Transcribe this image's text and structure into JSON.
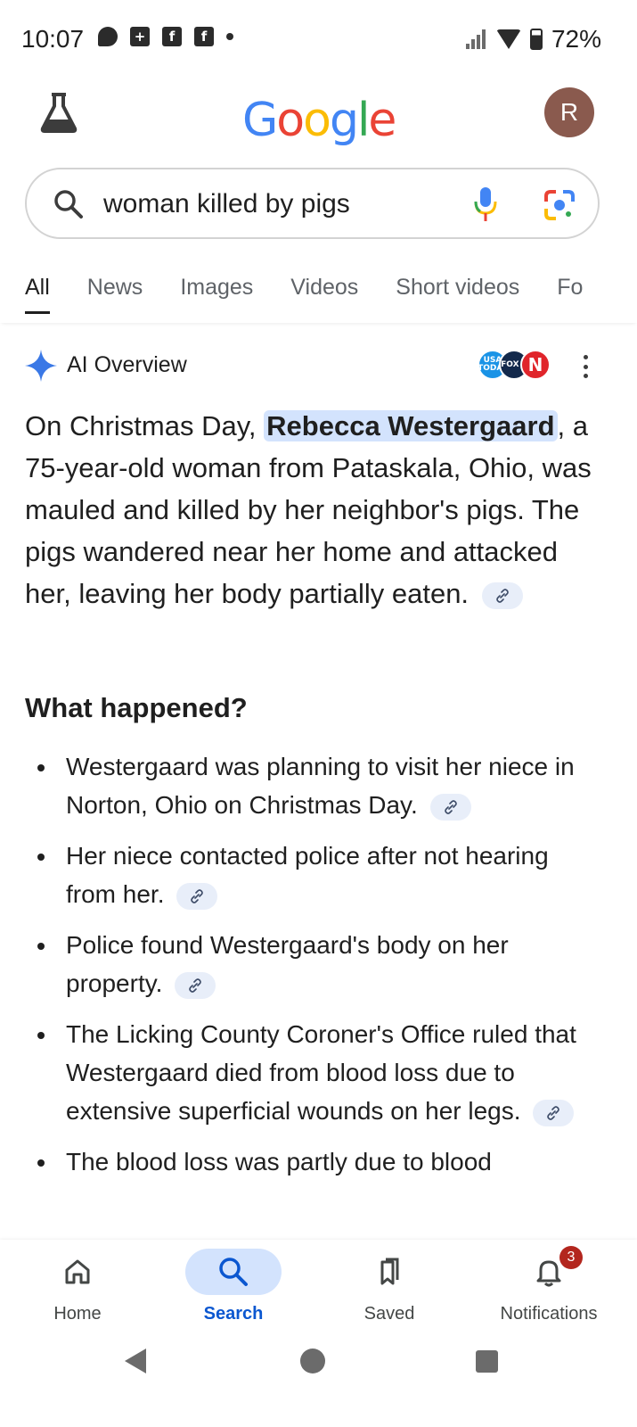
{
  "status_bar": {
    "time": "10:07",
    "battery": "72%",
    "left_icons": [
      "message-icon",
      "plus-icon",
      "facebook-icon",
      "facebook-icon",
      "dot-icon"
    ]
  },
  "header": {
    "logo_text": "Google",
    "avatar_letter": "R"
  },
  "search": {
    "query": "woman killed by pigs"
  },
  "tabs": [
    {
      "label": "All",
      "active": true
    },
    {
      "label": "News"
    },
    {
      "label": "Images"
    },
    {
      "label": "Videos"
    },
    {
      "label": "Short videos"
    },
    {
      "label": "Fo"
    }
  ],
  "ai_overview": {
    "title": "AI Overview",
    "sources": [
      "USA TODAY",
      "FOX 9",
      "N"
    ],
    "summary_before": "On Christmas Day, ",
    "summary_highlight": "Rebecca Westergaard",
    "summary_after": ", a 75-year-old woman from Pataskala, Ohio, was mauled and killed by her neighbor's pigs. The pigs wandered near her home and attacked her, leaving her body partially eaten.",
    "section_title": "What happened?",
    "bullets": [
      "Westergaard was planning to visit her niece in Norton, Ohio on Christmas Day.",
      "Her niece contacted police after not hearing from her.",
      "Police found Westergaard's body on her property.",
      "The Licking County Coroner's Office ruled that Westergaard died from blood loss due to extensive superficial wounds on her legs.",
      "The blood loss was partly due to blood"
    ]
  },
  "bottom_nav": {
    "items": [
      {
        "label": "Home",
        "icon": "home-icon"
      },
      {
        "label": "Search",
        "icon": "search-icon",
        "active": true
      },
      {
        "label": "Saved",
        "icon": "bookmark-icon"
      },
      {
        "label": "Notifications",
        "icon": "bell-icon",
        "badge": "3"
      }
    ]
  },
  "colors": {
    "accent": "#0b57d0",
    "highlight": "#d3e3fd",
    "avatar": "#8a5a4e",
    "badge": "#b3261e"
  }
}
